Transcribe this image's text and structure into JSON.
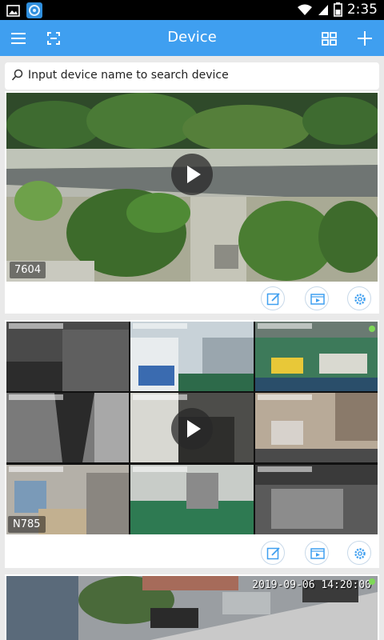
{
  "status_bar": {
    "time": "2:35",
    "icons": [
      "image-notification-icon",
      "app-notification-icon",
      "wifi-icon",
      "signal-icon",
      "battery-icon"
    ]
  },
  "app_bar": {
    "title": "Device",
    "icons": [
      "menu-icon",
      "scan-icon",
      "grid-view-icon",
      "add-icon"
    ]
  },
  "search": {
    "placeholder": "Input device name to search device"
  },
  "devices": [
    {
      "name": "7604",
      "view": "single"
    },
    {
      "name": "N785",
      "view": "grid"
    },
    {
      "timestamp": "2019-09-06 14:20:00",
      "view": "single"
    }
  ],
  "colors": {
    "accent": "#3f9ff0",
    "online": "#7ed957",
    "background": "#e9e9e9"
  }
}
